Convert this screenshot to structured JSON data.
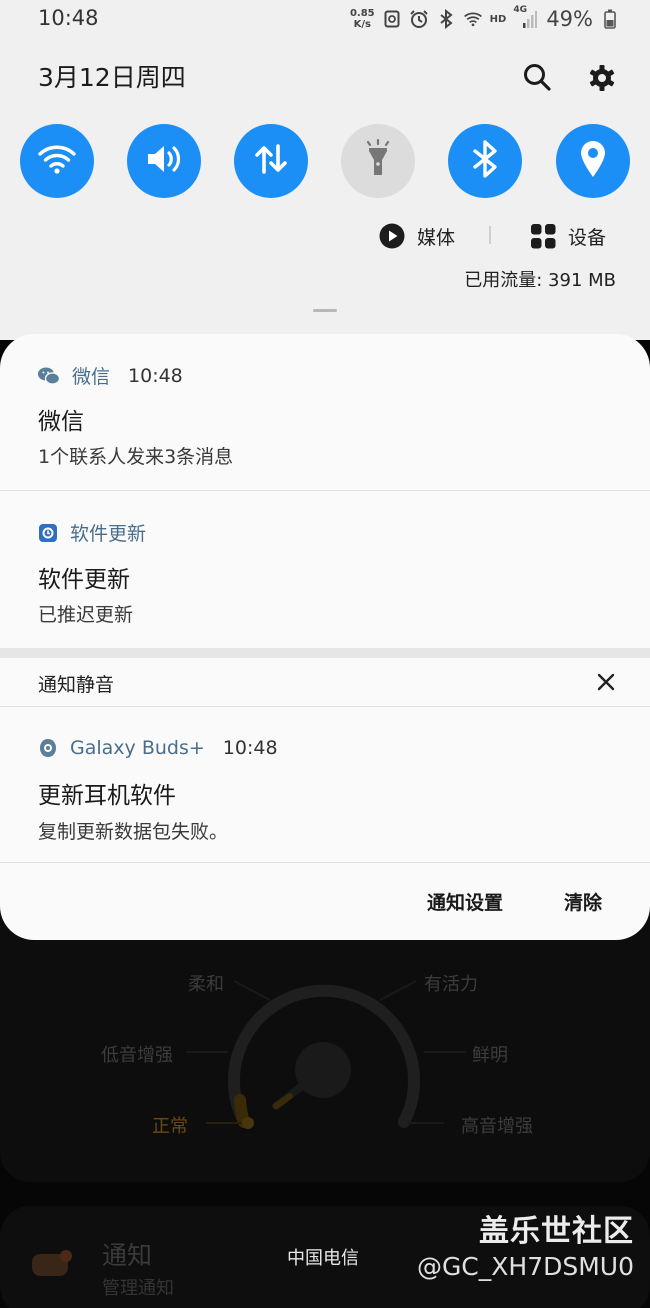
{
  "status_bar": {
    "time": "10:48",
    "net_speed_value": "0.85",
    "net_speed_unit": "K/s",
    "network_type": "HD",
    "cellular": "4G",
    "battery": "49%"
  },
  "quick_panel": {
    "date": "3月12日周四",
    "toggles": [
      {
        "name": "wifi-icon",
        "on": true
      },
      {
        "name": "sound-icon",
        "on": true
      },
      {
        "name": "mobile-data-icon",
        "on": true
      },
      {
        "name": "flashlight-icon",
        "on": false
      },
      {
        "name": "bluetooth-icon",
        "on": true
      },
      {
        "name": "location-icon",
        "on": true
      }
    ],
    "media_label": "媒体",
    "devices_label": "设备",
    "data_usage": "已用流量: 391 MB",
    "accent_color": "#1b8ff5"
  },
  "notifications": [
    {
      "app": "微信",
      "time": "10:48",
      "title": "微信",
      "body": "1个联系人发来3条消息"
    },
    {
      "app": "软件更新",
      "title": "软件更新",
      "body": "已推迟更新"
    }
  ],
  "silent_section": {
    "label": "通知静音",
    "items": [
      {
        "app": "Galaxy Buds+",
        "time": "10:48",
        "title": "更新耳机软件",
        "body": "复制更新数据包失败。"
      }
    ]
  },
  "actions": {
    "settings": "通知设置",
    "clear": "清除"
  },
  "background_app": {
    "eq_labels": {
      "soft": "柔和",
      "dynamic": "有活力",
      "bass_boost": "低音增强",
      "clear": "鲜明",
      "normal": "正常",
      "treble_boost": "高音增强"
    },
    "notify_title": "通知",
    "notify_sub": "管理通知"
  },
  "carrier": "中国电信",
  "watermark": {
    "title": "盖乐世社区",
    "user": "@GC_XH7DSMU0"
  }
}
